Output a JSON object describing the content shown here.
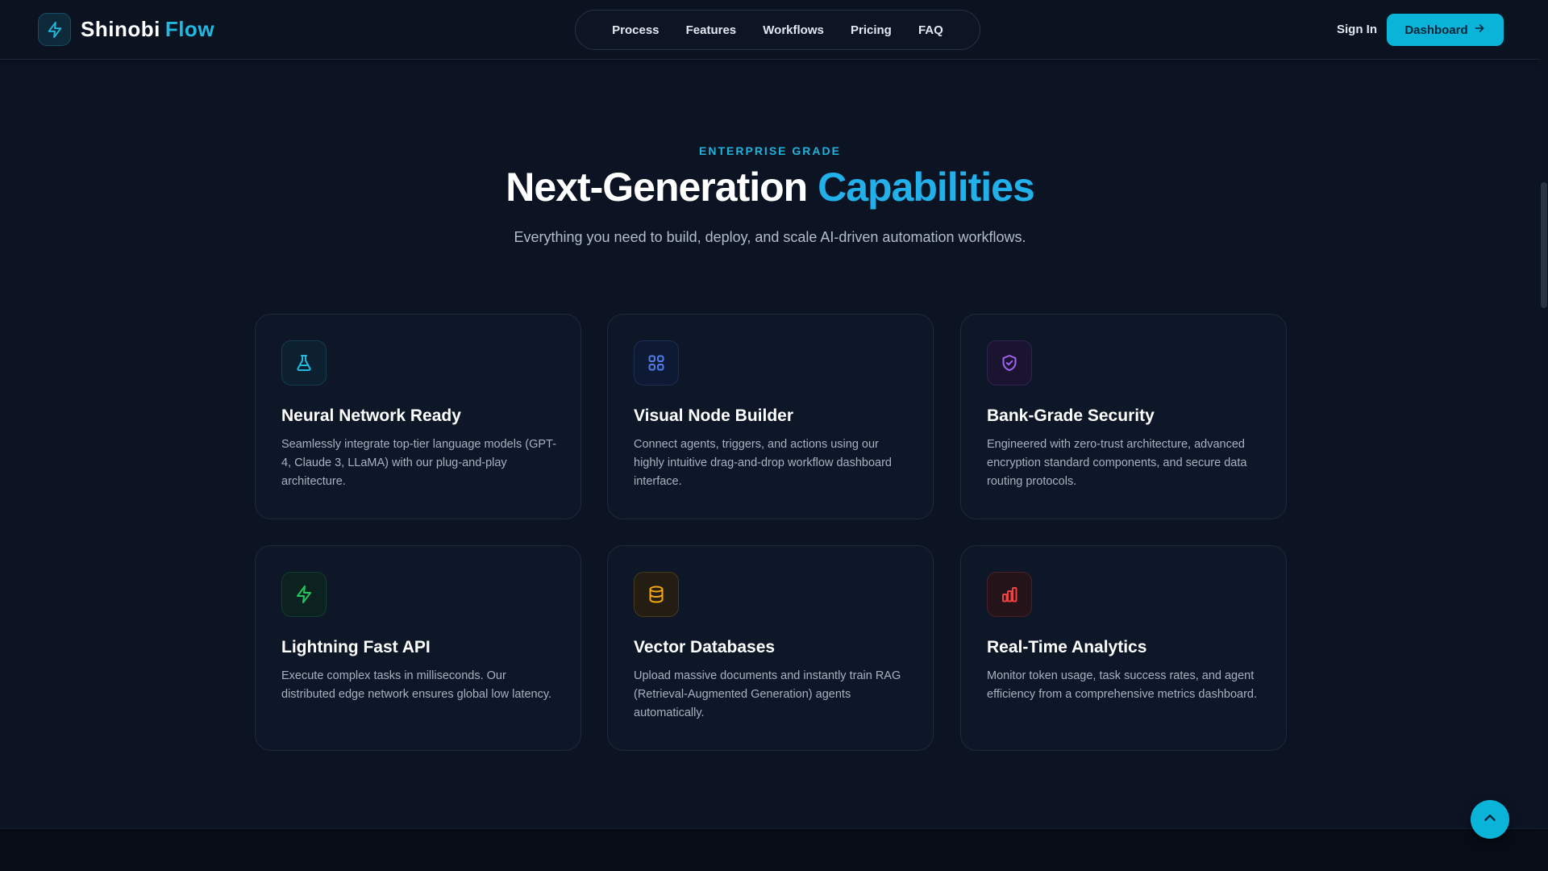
{
  "brand": {
    "name": "Shinobi",
    "accent": "Flow",
    "icon": "lightning-bolt-icon"
  },
  "nav": {
    "items": [
      "Process",
      "Features",
      "Workflows",
      "Pricing",
      "FAQ"
    ]
  },
  "header": {
    "signin": "Sign In",
    "dashboard": "Dashboard",
    "dashboard_icon": "arrow-right-icon"
  },
  "section": {
    "eyebrow": "ENTERPRISE GRADE",
    "title": "Next-Generation",
    "title_accent": "Capabilities",
    "subtitle": "Everything you need to build, deploy, and scale AI-driven automation workflows."
  },
  "features": [
    {
      "title": "Neural Network Ready",
      "desc": "Seamlessly integrate top-tier language models (GPT-4, Claude 3, LLaMA) with our plug-and-play architecture.",
      "icon": "flask-icon",
      "color": "#22b8e0"
    },
    {
      "title": "Visual Node Builder",
      "desc": "Connect agents, triggers, and actions using our highly intuitive drag-and-drop workflow dashboard interface.",
      "icon": "grid-icon",
      "color": "#4f7dea"
    },
    {
      "title": "Bank-Grade Security",
      "desc": "Engineered with zero-trust architecture, advanced encryption standard components, and secure data routing protocols.",
      "icon": "shield-check-icon",
      "color": "#a463f2"
    },
    {
      "title": "Lightning Fast API",
      "desc": "Execute complex tasks in milliseconds. Our distributed edge network ensures global low latency.",
      "icon": "lightning-bolt-icon",
      "color": "#22c55e"
    },
    {
      "title": "Vector Databases",
      "desc": "Upload massive documents and instantly train RAG (Retrieval-Augmented Generation) agents automatically.",
      "icon": "database-icon",
      "color": "#f5a60b"
    },
    {
      "title": "Real-Time Analytics",
      "desc": "Monitor token usage, task success rates, and agent efficiency from a comprehensive metrics dashboard.",
      "icon": "bar-chart-icon",
      "color": "#ef4444"
    }
  ],
  "scroll_top": {
    "icon": "chevron-up-icon"
  },
  "colors": {
    "accent": "#0ab4d8",
    "background": "#0c1424"
  }
}
